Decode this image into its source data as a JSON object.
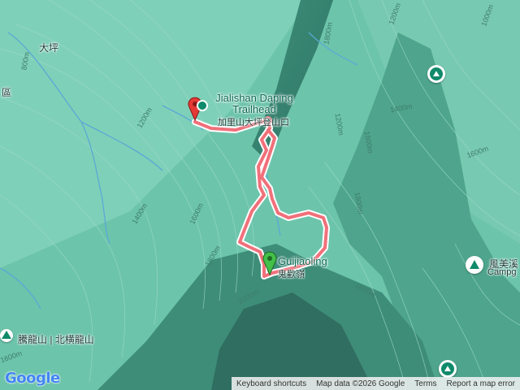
{
  "map": {
    "trailhead": {
      "name_en_line1": "Jialishan Daping",
      "name_en_line2": "Trailhead",
      "name_zh": "加里山大坪登山口"
    },
    "peak": {
      "name_en": "Guijiaoling",
      "name_zh": "鬼歡嶺"
    },
    "places": {
      "daping": "大坪",
      "district_fragment": "區",
      "tenglong": "騰龍山 | 北横龍山",
      "fengmei_zh": "風美溪",
      "fengmei_en": "Campg"
    },
    "elevation_labels": [
      "800m",
      "1200m",
      "1200m",
      "1400m",
      "1400m",
      "1600m",
      "1600m",
      "1600m",
      "1800m",
      "1800m",
      "1800m",
      "1800m",
      "2000m",
      "1600m",
      "1000m",
      "1200m"
    ],
    "colors": {
      "terrain": "#5fb8a0",
      "route": "#f0707a",
      "route_outline": "#ffffff",
      "poi": "#0f8a6a"
    }
  },
  "footer": {
    "google_logo": "Google",
    "keyboard_shortcuts": "Keyboard shortcuts",
    "map_data": "Map data ©2026 Google",
    "terms": "Terms",
    "report": "Report a map error"
  }
}
